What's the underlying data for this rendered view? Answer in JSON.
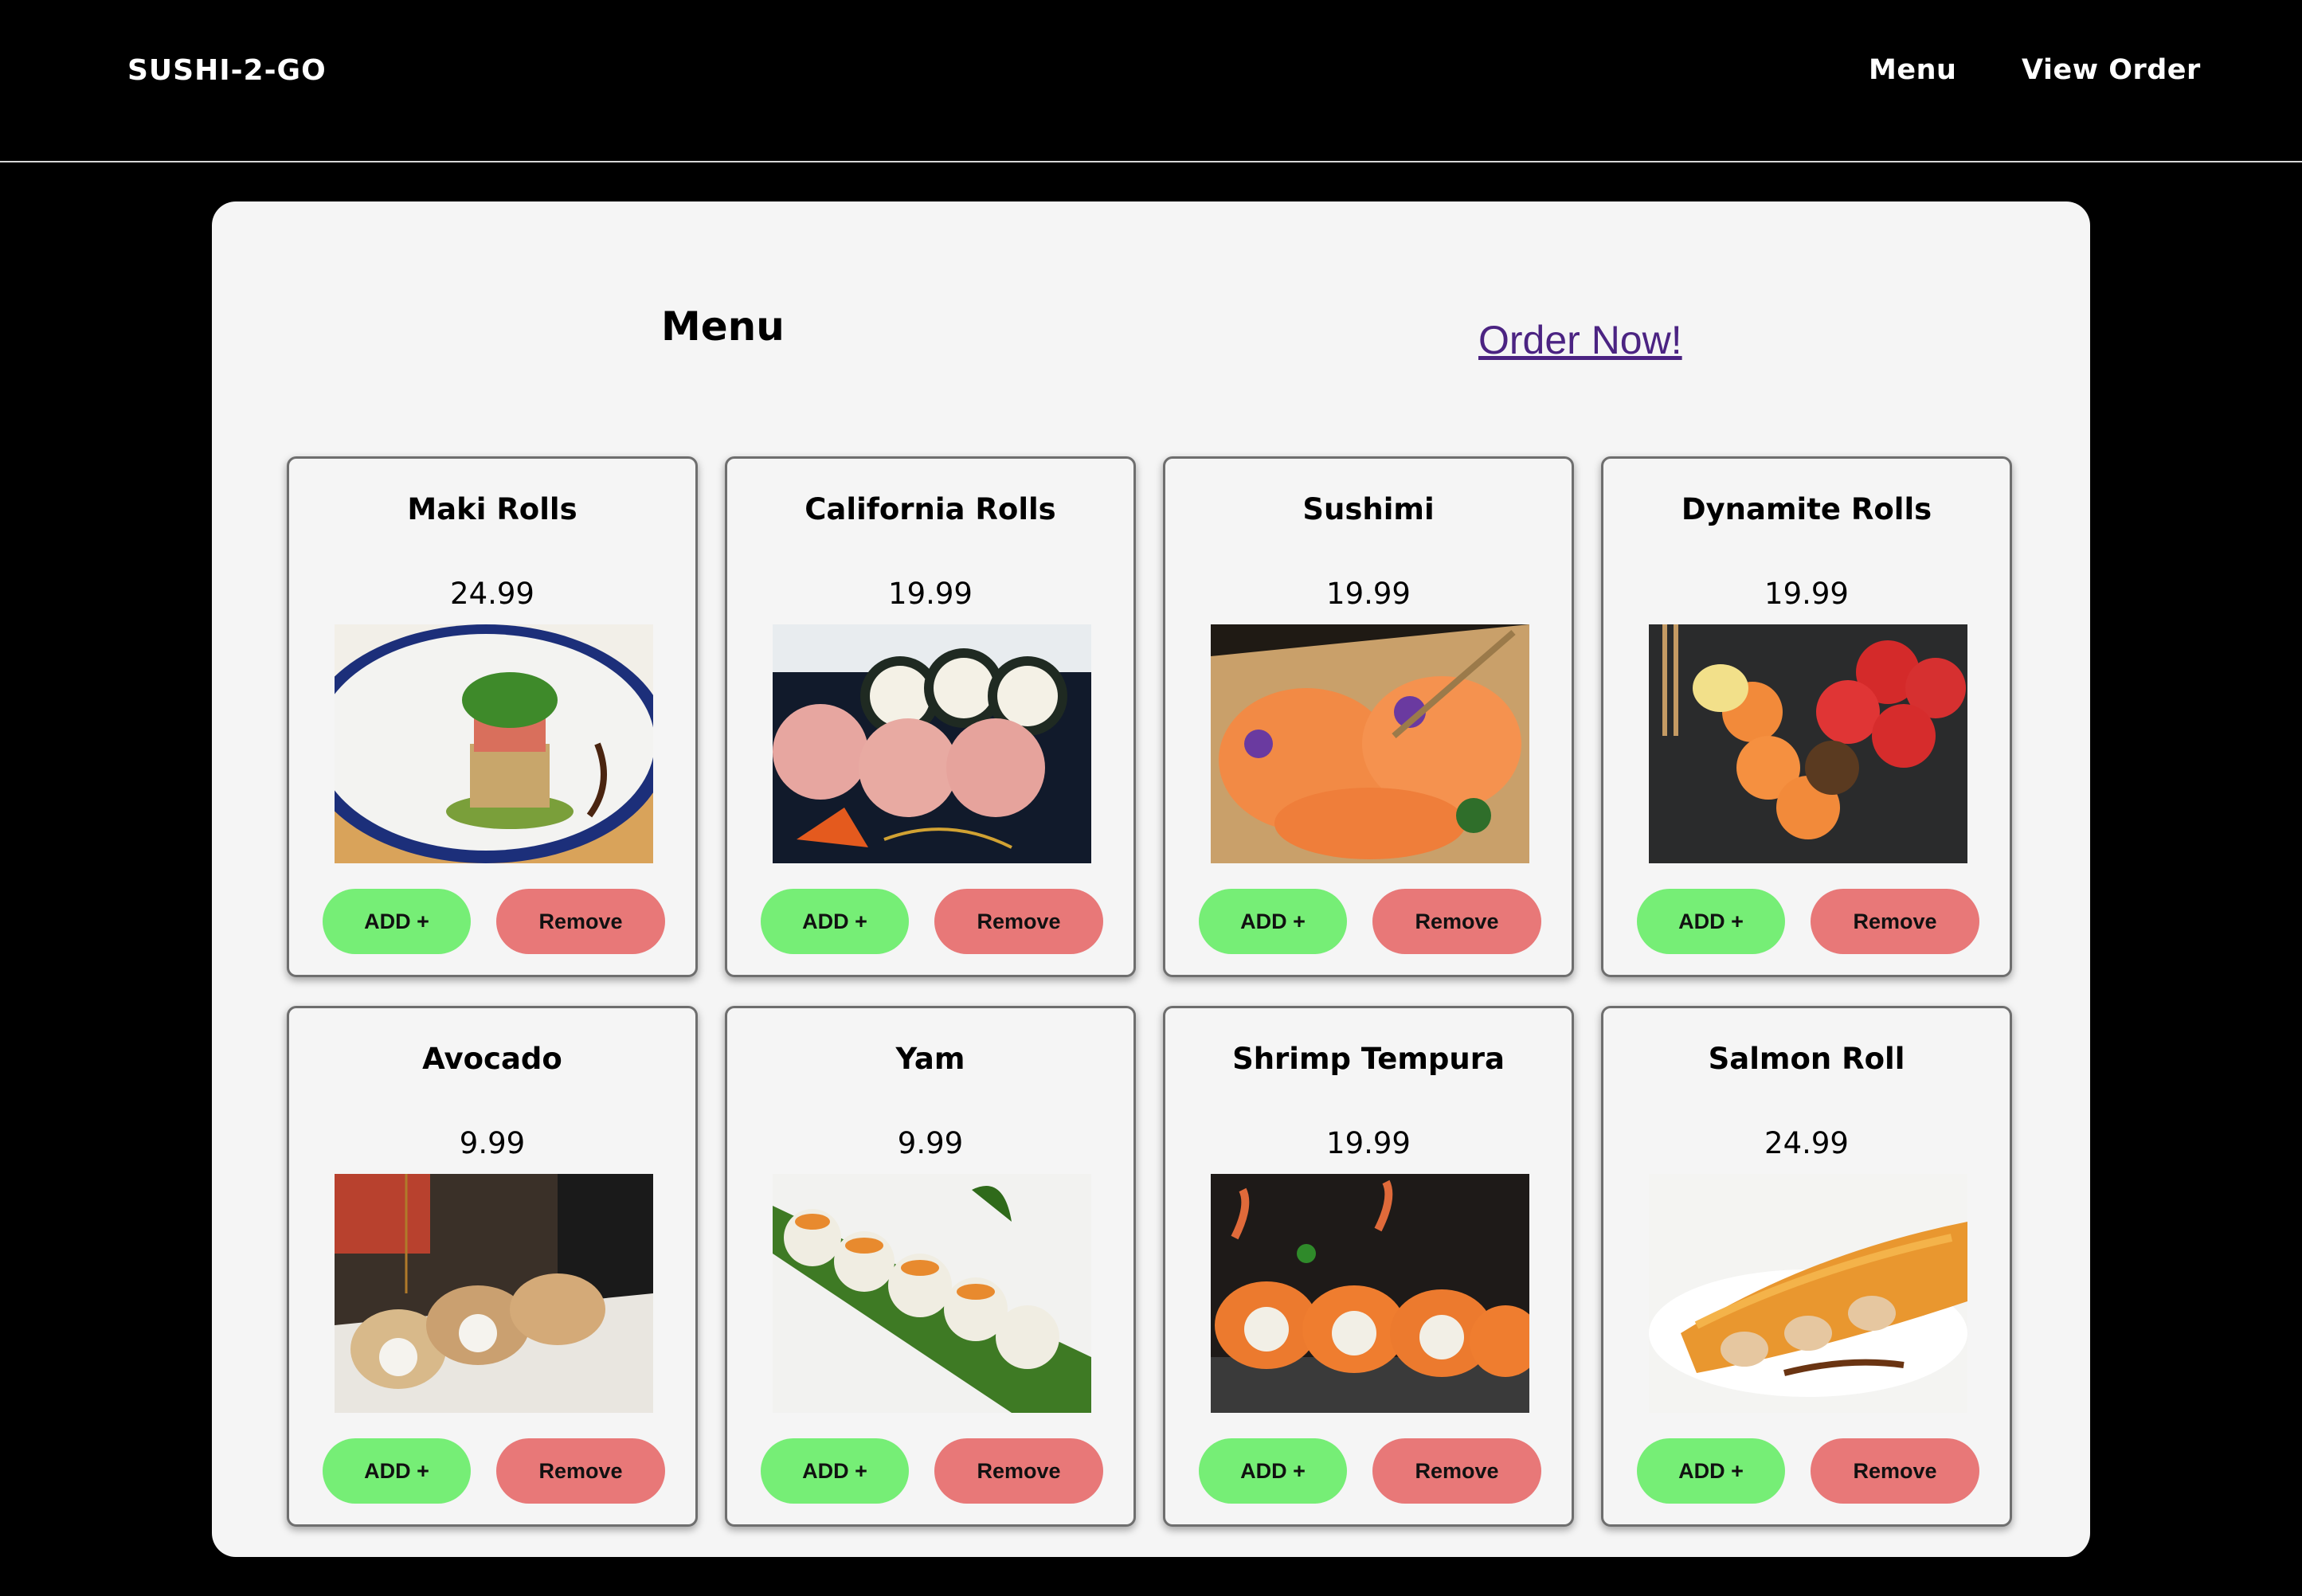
{
  "navbar": {
    "brand": "SUSHI-2-GO",
    "links": [
      "Menu",
      "View Order"
    ]
  },
  "main": {
    "title": "Menu",
    "order_link": "Order Now!",
    "buttons": {
      "add": "ADD +",
      "remove": "Remove"
    },
    "items": [
      {
        "name": "Maki Rolls",
        "price": "24.99"
      },
      {
        "name": "California Rolls",
        "price": "19.99"
      },
      {
        "name": "Sushimi",
        "price": "19.99"
      },
      {
        "name": "Dynamite Rolls",
        "price": "19.99"
      },
      {
        "name": "Avocado",
        "price": "9.99"
      },
      {
        "name": "Yam",
        "price": "9.99"
      },
      {
        "name": "Shrimp Tempura",
        "price": "19.99"
      },
      {
        "name": "Salmon Roll",
        "price": "24.99"
      }
    ]
  },
  "colors": {
    "background": "#000000",
    "panel": "#f5f5f5",
    "add_button": "#76ee76",
    "remove_button": "#e87878",
    "order_link": "#4b2382"
  }
}
